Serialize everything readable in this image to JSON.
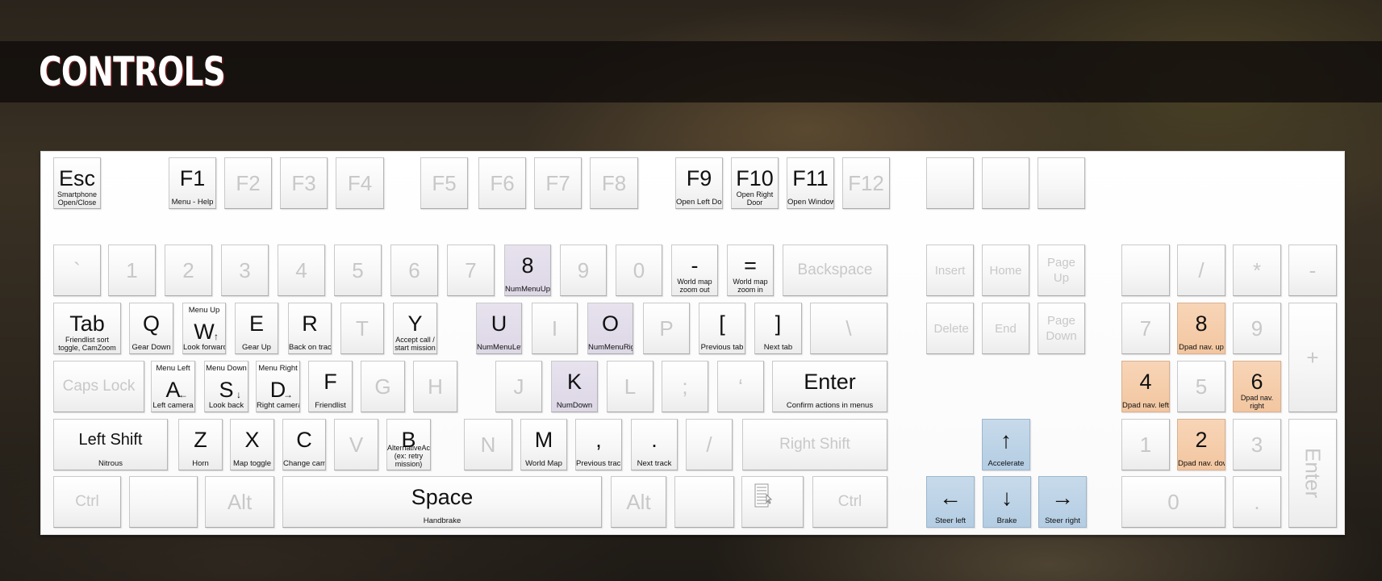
{
  "header": {
    "title": "CONTROLS"
  },
  "colors": {
    "purple": "#ddd7e6",
    "orange": "#f2c6a0",
    "blue": "#b4cde3",
    "inactive_text": "#c8c8c8"
  },
  "keys": {
    "esc": {
      "label": "Esc",
      "cap": "Smartphone Open/Close"
    },
    "f1": {
      "label": "F1",
      "cap": "Menu - Help"
    },
    "f2": {
      "label": "F2"
    },
    "f3": {
      "label": "F3"
    },
    "f4": {
      "label": "F4"
    },
    "f5": {
      "label": "F5"
    },
    "f6": {
      "label": "F6"
    },
    "f7": {
      "label": "F7"
    },
    "f8": {
      "label": "F8"
    },
    "f9": {
      "label": "F9",
      "cap": "Open Left Door"
    },
    "f10": {
      "label": "F10",
      "cap": "Open Right Door"
    },
    "f11": {
      "label": "F11",
      "cap": "Open Windows"
    },
    "f12": {
      "label": "F12"
    },
    "backtick": {
      "label": "`"
    },
    "n1": {
      "label": "1"
    },
    "n2": {
      "label": "2"
    },
    "n3": {
      "label": "3"
    },
    "n4": {
      "label": "4"
    },
    "n5": {
      "label": "5"
    },
    "n6": {
      "label": "6"
    },
    "n7": {
      "label": "7"
    },
    "n8": {
      "label": "8",
      "cap": "NumMenuUp"
    },
    "n9": {
      "label": "9"
    },
    "n0": {
      "label": "0"
    },
    "minus": {
      "label": "-",
      "cap": "World map zoom out"
    },
    "equals": {
      "label": "=",
      "cap": "World map zoom in"
    },
    "backspace": {
      "label": "Backspace"
    },
    "tab": {
      "label": "Tab",
      "cap": "Friendlist sort toggle, CamZoom"
    },
    "q": {
      "label": "Q",
      "cap": "Gear Down"
    },
    "w": {
      "label": "W",
      "cap_top": "Menu Up",
      "cap": "Look forward",
      "mini_arrow": "↑"
    },
    "e": {
      "label": "E",
      "cap": "Gear Up"
    },
    "r": {
      "label": "R",
      "cap": "Back on track"
    },
    "t": {
      "label": "T"
    },
    "y": {
      "label": "Y",
      "cap": "Accept call / start mission"
    },
    "u": {
      "label": "U",
      "cap": "NumMenuLeft"
    },
    "i": {
      "label": "I"
    },
    "o": {
      "label": "O",
      "cap": "NumMenuRight"
    },
    "p": {
      "label": "P"
    },
    "lbracket": {
      "label": "[",
      "cap": "Previous  tab"
    },
    "rbracket": {
      "label": "]",
      "cap": "Next tab"
    },
    "backslash": {
      "label": "\\"
    },
    "capslock": {
      "label": "Caps Lock"
    },
    "a": {
      "label": "A",
      "cap_top": "Menu Left",
      "cap": "Left camera",
      "mini_arrow": "←"
    },
    "s": {
      "label": "S",
      "cap_top": "Menu Down",
      "cap": "Look back",
      "mini_arrow": "↓"
    },
    "d": {
      "label": "D",
      "cap_top": "Menu Right",
      "cap": "Right camera",
      "mini_arrow": "→"
    },
    "f": {
      "label": "F",
      "cap": "Friendlist"
    },
    "g": {
      "label": "G"
    },
    "h": {
      "label": "H"
    },
    "j": {
      "label": "J"
    },
    "k": {
      "label": "K",
      "cap": "NumDown"
    },
    "l": {
      "label": "L"
    },
    "semicolon": {
      "label": ";"
    },
    "quote": {
      "label": "‘"
    },
    "enter": {
      "label": "Enter",
      "cap": "Confirm actions in menus"
    },
    "lshift": {
      "label": "Left Shift",
      "cap": "Nitrous"
    },
    "z": {
      "label": "Z",
      "cap": "Horn"
    },
    "x": {
      "label": "X",
      "cap": "Map toggle"
    },
    "c": {
      "label": "C",
      "cap": "Change camera"
    },
    "v": {
      "label": "V"
    },
    "b": {
      "label": "B",
      "cap": "AlternativeAction (ex: retry mission)"
    },
    "n": {
      "label": "N"
    },
    "m": {
      "label": "M",
      "cap": "World Map"
    },
    "comma": {
      "label": ",",
      "cap": "Previous track"
    },
    "period": {
      "label": ".",
      "cap": "Next track"
    },
    "slash": {
      "label": "/"
    },
    "rshift": {
      "label": "Right Shift"
    },
    "lctrl": {
      "label": "Ctrl"
    },
    "lalt": {
      "label": "Alt"
    },
    "space": {
      "label": "Space",
      "cap": "Handbrake"
    },
    "ralt": {
      "label": "Alt"
    },
    "rctrl": {
      "label": "Ctrl"
    },
    "insert": {
      "label": "Insert"
    },
    "home": {
      "label": "Home"
    },
    "pageup": {
      "label": "Page Up"
    },
    "delete": {
      "label": "Delete"
    },
    "end": {
      "label": "End"
    },
    "pagedown": {
      "label": "Page Down"
    },
    "up": {
      "label": "↑",
      "cap": "Accelerate"
    },
    "left": {
      "label": "←",
      "cap": "Steer left"
    },
    "down": {
      "label": "↓",
      "cap": "Brake"
    },
    "right": {
      "label": "→",
      "cap": "Steer right"
    },
    "np_slash": {
      "label": "/"
    },
    "np_star": {
      "label": "*"
    },
    "np_minus": {
      "label": "-"
    },
    "np7": {
      "label": "7"
    },
    "np8": {
      "label": "8",
      "cap": "Dpad nav. up"
    },
    "np9": {
      "label": "9"
    },
    "np_plus": {
      "label": "+"
    },
    "np4": {
      "label": "4",
      "cap": "Dpad nav. left"
    },
    "np5": {
      "label": "5"
    },
    "np6": {
      "label": "6",
      "cap": "Dpad nav. right"
    },
    "np1": {
      "label": "1"
    },
    "np2": {
      "label": "2",
      "cap": "Dpad nav. down"
    },
    "np3": {
      "label": "3"
    },
    "np_enter": {
      "label": "Enter"
    },
    "np0": {
      "label": "0"
    },
    "np_dot": {
      "label": "."
    }
  }
}
